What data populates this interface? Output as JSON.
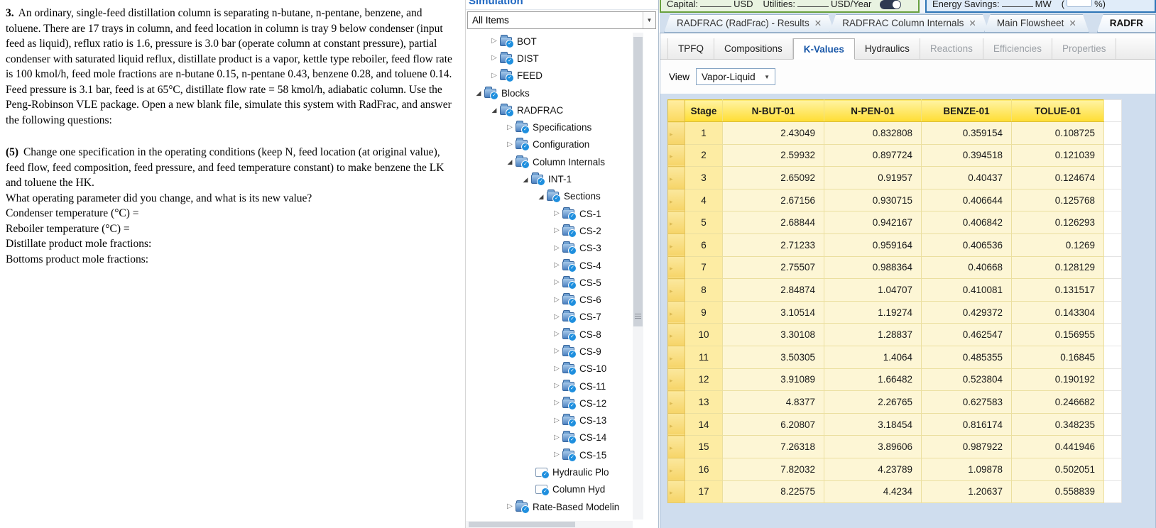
{
  "document": {
    "q3_label": "3.",
    "q3_text": "An ordinary, single-feed distillation column is separating n-butane, n-pentane, benzene, and toluene. There are 17 trays in column, and feed location in column is tray 9 below condenser (input feed as liquid), reflux ratio is 1.6, pressure is 3.0 bar (operate column at constant pressure), partial condenser with saturated liquid reflux, distillate product is a vapor, kettle type reboiler, feed flow rate is 100 kmol/h, feed mole fractions are n-butane 0.15, n-pentane 0.43, benzene 0.28, and toluene 0.14. Feed pressure is 3.1 bar, feed is at 65°C, distillate flow rate = 58 kmol/h, adiabatic column. Use the Peng-Robinson VLE package. Open a new blank file, simulate this system with RadFrac, and answer the following questions:",
    "q5_label": "(5)",
    "q5_text": "Change one specification in the operating conditions (keep N, feed location (at original value), feed flow, feed composition, feed pressure, and feed temperature constant) to make benzene the LK and toluene the HK.",
    "prompt_lines": [
      "What operating parameter did you change, and what is its new value?",
      "Condenser temperature (°C) =",
      "Reboiler temperature (°C) =",
      "Distillate product mole fractions:",
      "Bottoms product mole fractions:"
    ]
  },
  "navigation": {
    "panel_title": "Simulation",
    "filter_value": "All Items",
    "tree": [
      {
        "label": "BOT",
        "level": 1,
        "state": "collapsed"
      },
      {
        "label": "DIST",
        "level": 1,
        "state": "collapsed"
      },
      {
        "label": "FEED",
        "level": 1,
        "state": "collapsed"
      },
      {
        "label": "Blocks",
        "level": 0,
        "state": "expanded"
      },
      {
        "label": "RADFRAC",
        "level": 1,
        "state": "expanded"
      },
      {
        "label": "Specifications",
        "level": 2,
        "state": "collapsed"
      },
      {
        "label": "Configuration",
        "level": 2,
        "state": "collapsed"
      },
      {
        "label": "Column Internals",
        "level": 2,
        "state": "expanded"
      },
      {
        "label": "INT-1",
        "level": 3,
        "state": "expanded"
      },
      {
        "label": "Sections",
        "level": 4,
        "state": "expanded"
      },
      {
        "label": "CS-1",
        "level": 5,
        "state": "collapsed"
      },
      {
        "label": "CS-2",
        "level": 5,
        "state": "collapsed"
      },
      {
        "label": "CS-3",
        "level": 5,
        "state": "collapsed"
      },
      {
        "label": "CS-4",
        "level": 5,
        "state": "collapsed"
      },
      {
        "label": "CS-5",
        "level": 5,
        "state": "collapsed"
      },
      {
        "label": "CS-6",
        "level": 5,
        "state": "collapsed"
      },
      {
        "label": "CS-7",
        "level": 5,
        "state": "collapsed"
      },
      {
        "label": "CS-8",
        "level": 5,
        "state": "collapsed"
      },
      {
        "label": "CS-9",
        "level": 5,
        "state": "collapsed"
      },
      {
        "label": "CS-10",
        "level": 5,
        "state": "collapsed"
      },
      {
        "label": "CS-11",
        "level": 5,
        "state": "collapsed"
      },
      {
        "label": "CS-12",
        "level": 5,
        "state": "collapsed"
      },
      {
        "label": "CS-13",
        "level": 5,
        "state": "collapsed"
      },
      {
        "label": "CS-14",
        "level": 5,
        "state": "collapsed"
      },
      {
        "label": "CS-15",
        "level": 5,
        "state": "collapsed"
      },
      {
        "label": "Hydraulic Plo",
        "level": 4,
        "icon": "form"
      },
      {
        "label": "Column Hyd",
        "level": 4,
        "icon": "form"
      },
      {
        "label": "Rate-Based Modelin",
        "level": 2,
        "state": "collapsed"
      }
    ]
  },
  "topbar": {
    "capital_label": "Capital:",
    "capital_unit": "USD",
    "utilities_label": "Utilities:",
    "utilities_unit": "USD/Year",
    "energy_label": "Energy Savings:",
    "energy_unit": "MW",
    "energy_open": "(",
    "energy_suffix": "%)"
  },
  "tabs": [
    {
      "label": "RADFRAC (RadFrac) - Results"
    },
    {
      "label": "RADFRAC Column Internals"
    },
    {
      "label": "Main Flowsheet"
    },
    {
      "label": "RADFR"
    }
  ],
  "subtabs": [
    {
      "label": "TPFQ",
      "state": "normal"
    },
    {
      "label": "Compositions",
      "state": "normal"
    },
    {
      "label": "K-Values",
      "state": "active"
    },
    {
      "label": "Hydraulics",
      "state": "normal"
    },
    {
      "label": "Reactions",
      "state": "disabled"
    },
    {
      "label": "Efficiencies",
      "state": "disabled"
    },
    {
      "label": "Properties",
      "state": "disabled"
    }
  ],
  "view": {
    "label": "View",
    "value": "Vapor-Liquid"
  },
  "kvalues_table": {
    "type": "table",
    "headers": [
      "Stage",
      "N-BUT-01",
      "N-PEN-01",
      "BENZE-01",
      "TOLUE-01"
    ],
    "rows": [
      [
        1,
        "2.43049",
        "0.832808",
        "0.359154",
        "0.108725"
      ],
      [
        2,
        "2.59932",
        "0.897724",
        "0.394518",
        "0.121039"
      ],
      [
        3,
        "2.65092",
        "0.91957",
        "0.40437",
        "0.124674"
      ],
      [
        4,
        "2.67156",
        "0.930715",
        "0.406644",
        "0.125768"
      ],
      [
        5,
        "2.68844",
        "0.942167",
        "0.406842",
        "0.126293"
      ],
      [
        6,
        "2.71233",
        "0.959164",
        "0.406536",
        "0.1269"
      ],
      [
        7,
        "2.75507",
        "0.988364",
        "0.40668",
        "0.128129"
      ],
      [
        8,
        "2.84874",
        "1.04707",
        "0.410081",
        "0.131517"
      ],
      [
        9,
        "3.10514",
        "1.19274",
        "0.429372",
        "0.143304"
      ],
      [
        10,
        "3.30108",
        "1.28837",
        "0.462547",
        "0.156955"
      ],
      [
        11,
        "3.50305",
        "1.4064",
        "0.485355",
        "0.16845"
      ],
      [
        12,
        "3.91089",
        "1.66482",
        "0.523804",
        "0.190192"
      ],
      [
        13,
        "4.8377",
        "2.26765",
        "0.627583",
        "0.246682"
      ],
      [
        14,
        "6.20807",
        "3.18454",
        "0.816174",
        "0.348235"
      ],
      [
        15,
        "7.26318",
        "3.89606",
        "0.987922",
        "0.441946"
      ],
      [
        16,
        "7.82032",
        "4.23789",
        "1.09878",
        "0.502051"
      ],
      [
        17,
        "8.22575",
        "4.4234",
        "1.20637",
        "0.558839"
      ]
    ]
  }
}
